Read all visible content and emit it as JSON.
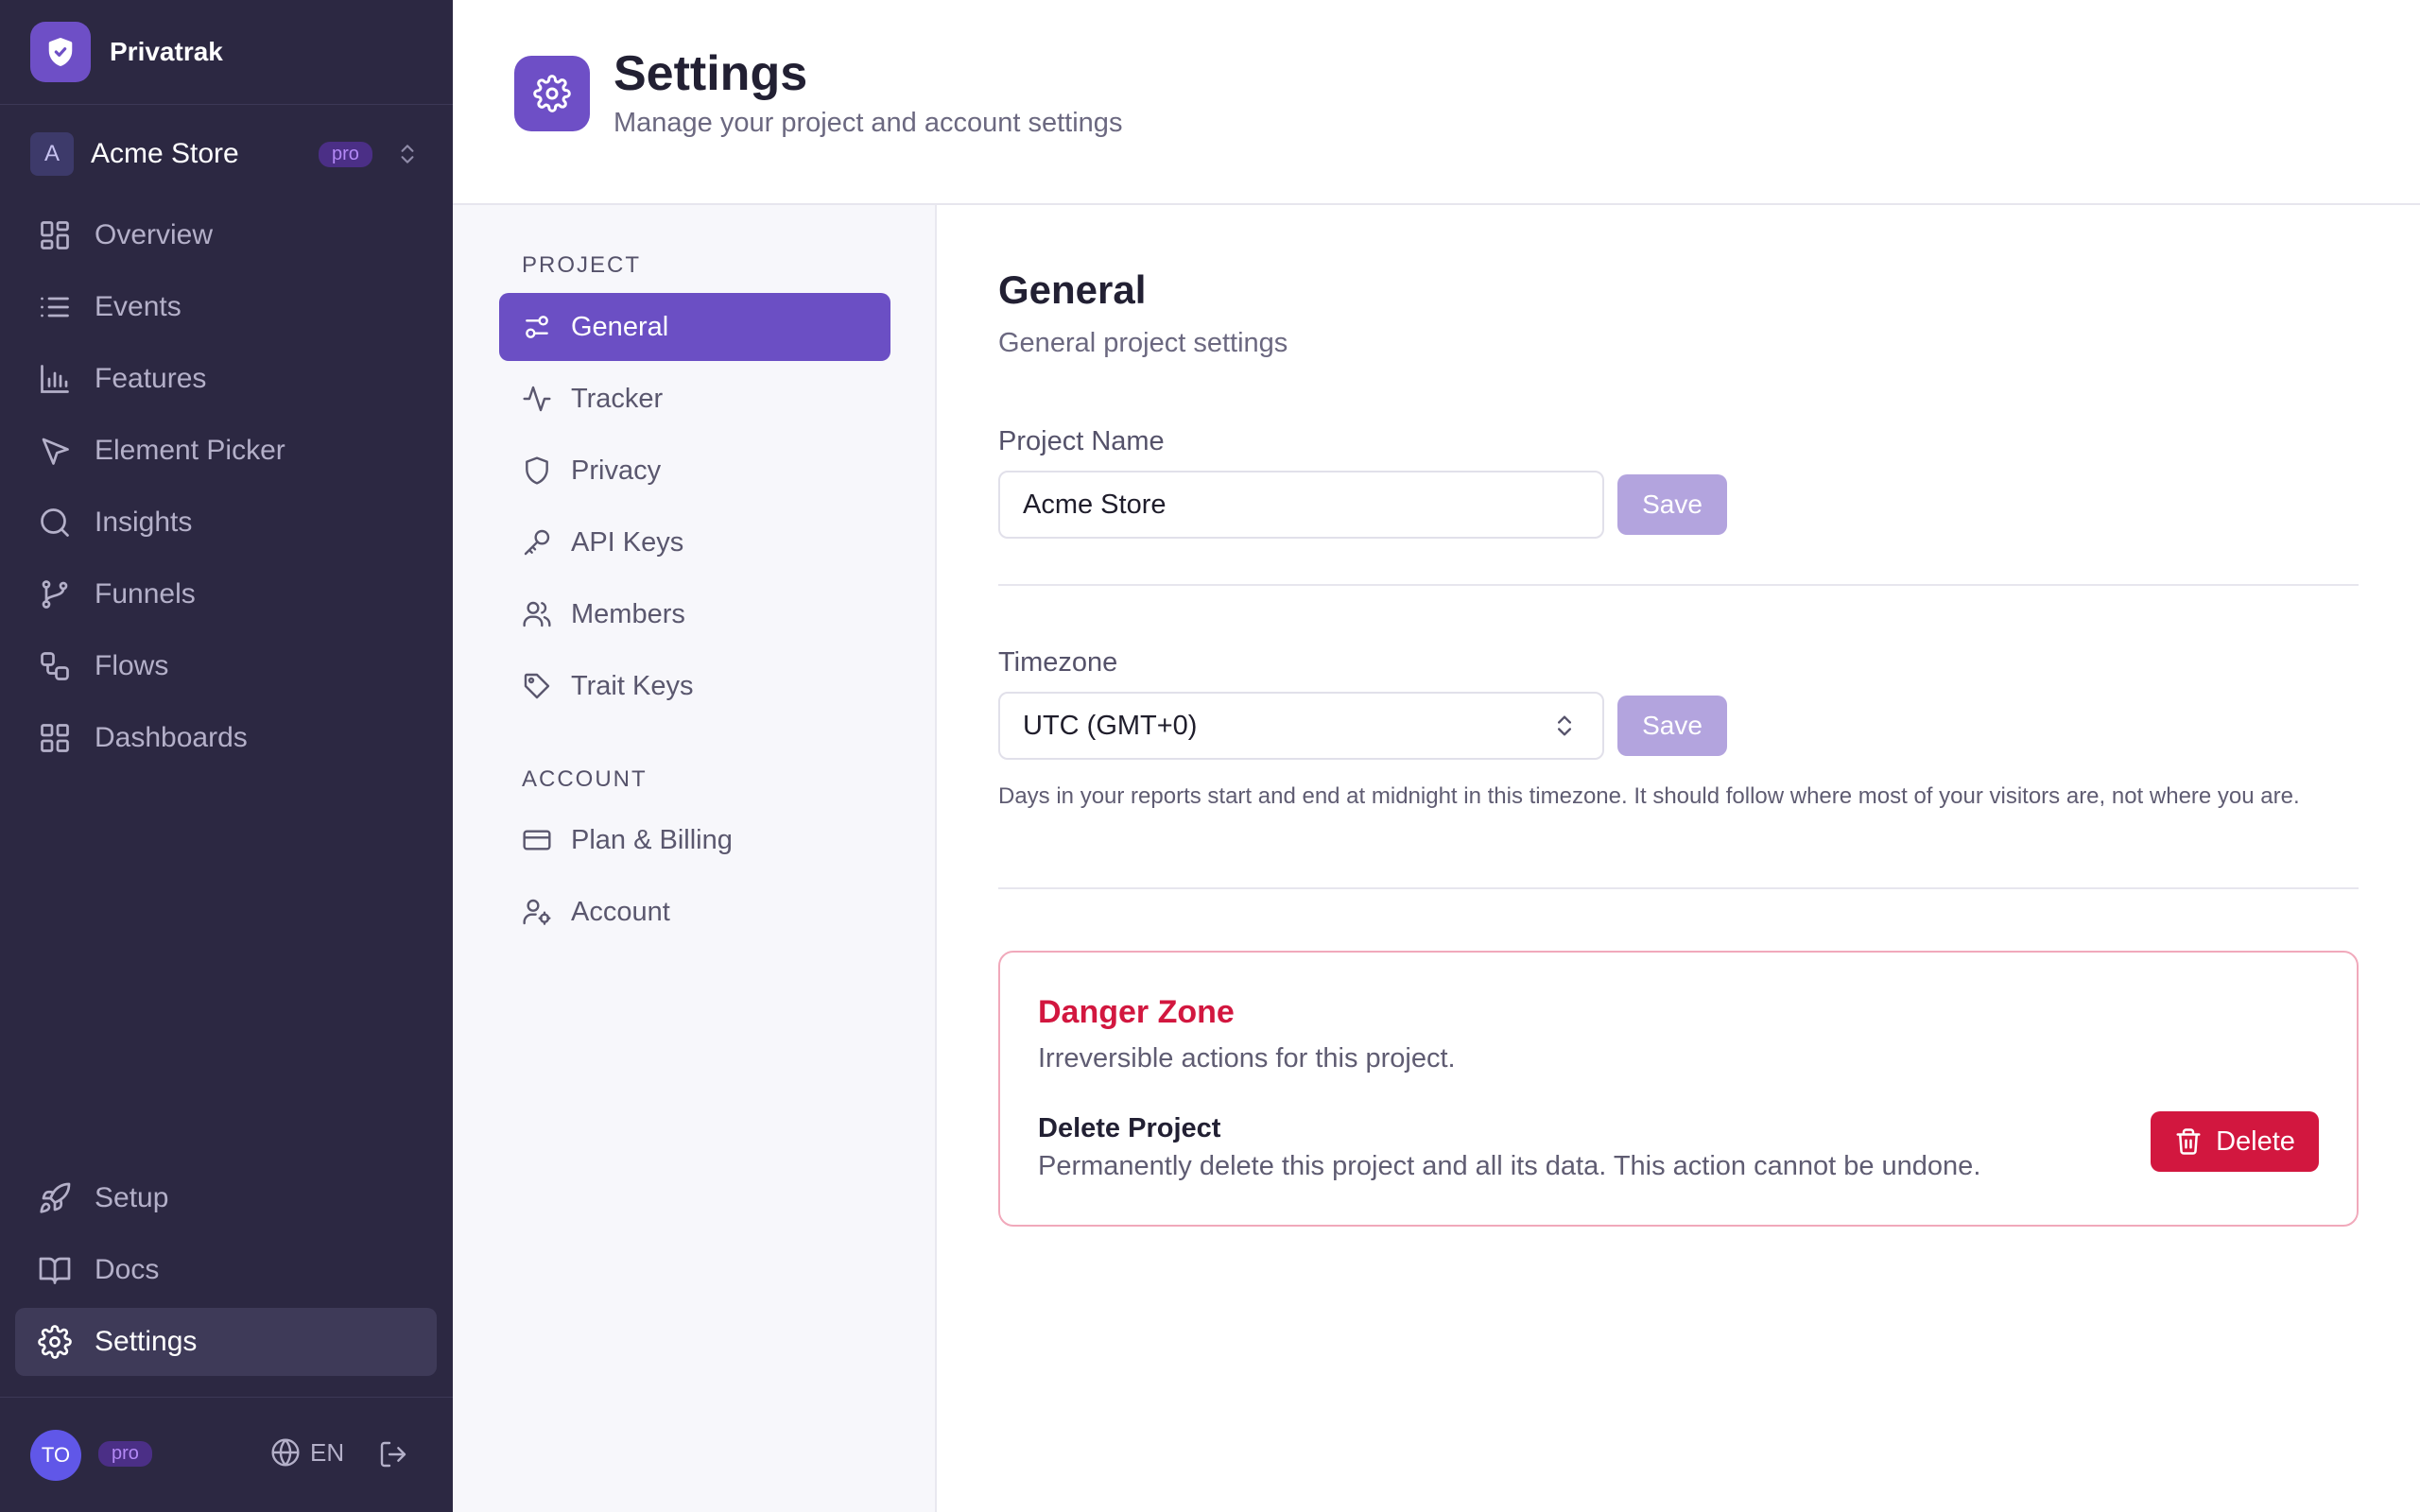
{
  "app": {
    "name": "Privatrak",
    "project": {
      "initial": "A",
      "name": "Acme Store",
      "plan_badge": "pro"
    },
    "nav_main": [
      {
        "label": "Overview",
        "icon": "grid-icon"
      },
      {
        "label": "Events",
        "icon": "list-icon"
      },
      {
        "label": "Features",
        "icon": "bar-chart-icon"
      },
      {
        "label": "Element Picker",
        "icon": "cursor-icon"
      },
      {
        "label": "Insights",
        "icon": "search-icon"
      },
      {
        "label": "Funnels",
        "icon": "git-branch-icon"
      },
      {
        "label": "Flows",
        "icon": "workflow-icon"
      },
      {
        "label": "Dashboards",
        "icon": "dashboard-icon"
      }
    ],
    "nav_bottom": [
      {
        "label": "Setup",
        "icon": "rocket-icon"
      },
      {
        "label": "Docs",
        "icon": "book-icon"
      },
      {
        "label": "Settings",
        "icon": "gear-icon",
        "active": true
      }
    ],
    "user": {
      "initials": "TO",
      "plan_badge": "pro",
      "language": "EN"
    }
  },
  "header": {
    "title": "Settings",
    "subtitle": "Manage your project and account settings"
  },
  "settings_nav": {
    "project_label": "PROJECT",
    "project_items": [
      {
        "label": "General",
        "icon": "sliders-icon",
        "active": true
      },
      {
        "label": "Tracker",
        "icon": "activity-icon"
      },
      {
        "label": "Privacy",
        "icon": "shield-icon"
      },
      {
        "label": "API Keys",
        "icon": "key-icon"
      },
      {
        "label": "Members",
        "icon": "users-icon"
      },
      {
        "label": "Trait Keys",
        "icon": "tag-icon"
      }
    ],
    "account_label": "ACCOUNT",
    "account_items": [
      {
        "label": "Plan & Billing",
        "icon": "credit-card-icon"
      },
      {
        "label": "Account",
        "icon": "user-cog-icon"
      }
    ]
  },
  "general": {
    "title": "General",
    "subtitle": "General project settings",
    "project_name_label": "Project Name",
    "project_name_value": "Acme Store",
    "timezone_label": "Timezone",
    "timezone_value": "UTC (GMT+0)",
    "timezone_help": "Days in your reports start and end at midnight in this timezone. It should follow where most of your visitors are, not where you are.",
    "save_label": "Save"
  },
  "danger_zone": {
    "title": "Danger Zone",
    "description": "Irreversible actions for this project.",
    "item_title": "Delete Project",
    "item_description": "Permanently delete this project and all its data. This action cannot be undone.",
    "delete_label": "Delete"
  },
  "colors": {
    "sidebar_bg": "#2c2842",
    "accent": "#6b4fc4",
    "save_disabled": "#b3a4de",
    "danger": "#d2173f",
    "danger_border": "#f1a9bb"
  }
}
